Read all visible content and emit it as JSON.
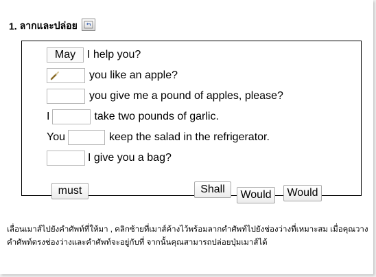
{
  "title": {
    "number": "1.",
    "text": "ลากและปล่อย"
  },
  "sentences": [
    {
      "before": "",
      "slot": "May",
      "after": "I help you?"
    },
    {
      "before": "",
      "slot": "",
      "after": "you like an apple?"
    },
    {
      "before": "",
      "slot": "",
      "after": "you give me a pound of apples, please?"
    },
    {
      "before": "I",
      "slot": "",
      "after": "take two pounds of garlic."
    },
    {
      "before": "You",
      "slot": "",
      "after": "keep the salad in the refrigerator."
    },
    {
      "before": "",
      "slot": "",
      "after": "I give you a bag?"
    }
  ],
  "word_bank": [
    "must",
    "Shall",
    "Would",
    "Would"
  ],
  "instructions": "เลื่อนเมาส์ไปยังคำศัพท์ที่ให้มา , คลิกซ้ายที่เมาส์ค้างไว้พร้อมลากคำศัพท์ไปยังช่องว่างที่เหมาะสม เมื่อคุณวางคำศัพท์ตรงช่องว่างและคำศัพท์จะอยู่กับที่ จากนั้นคุณสามารถปล่อยปุ่มเมาส์ได้"
}
